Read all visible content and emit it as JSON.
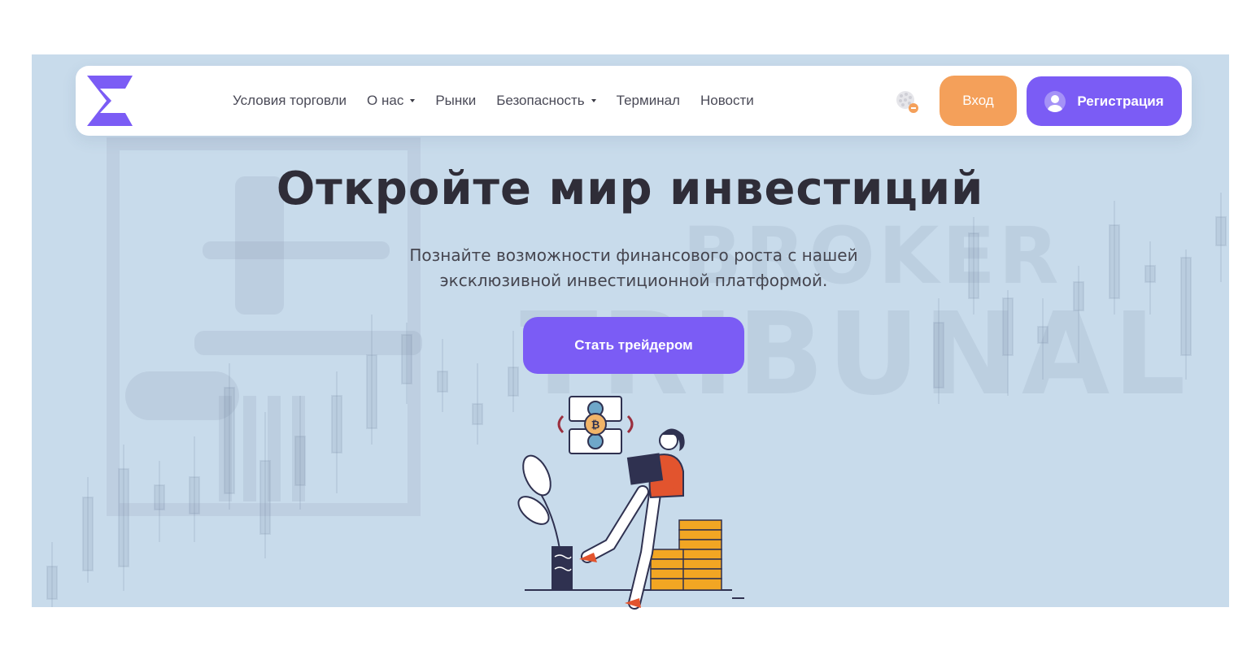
{
  "brand": {
    "logo_icon": "e-logo-icon",
    "accent": "#7b5cf5",
    "secondary": "#f4a05a"
  },
  "navbar": {
    "links": [
      {
        "label": "Условия торговли",
        "has_dropdown": false
      },
      {
        "label": "О нас",
        "has_dropdown": true
      },
      {
        "label": "Рынки",
        "has_dropdown": false
      },
      {
        "label": "Безопасность",
        "has_dropdown": true
      },
      {
        "label": "Терминал",
        "has_dropdown": false
      },
      {
        "label": "Новости",
        "has_dropdown": false
      }
    ],
    "language_icon": "globe-icon",
    "login_label": "Вход",
    "register_label": "Регистрация",
    "register_icon": "user-avatar-icon"
  },
  "hero": {
    "title": "Откройте мир инвестиций",
    "subtitle": "Познайте возможности финансового роста с нашей эксклюзивной инвестиционной платформой.",
    "cta_label": "Стать трейдером",
    "illustration": "woman-with-laptop-on-coins-illustration"
  },
  "watermark": {
    "line1": "BROKER",
    "line2": "TRIBUNAL"
  }
}
